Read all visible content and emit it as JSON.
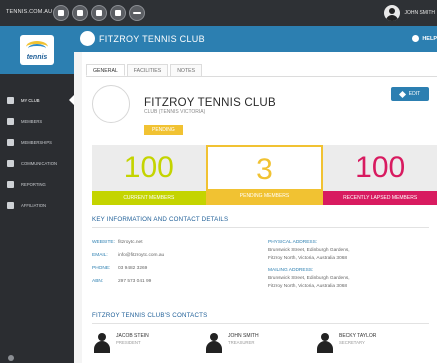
{
  "topbar": {
    "brand": "TENNIS.COM.AU",
    "icons": [
      "square-icon",
      "shield-icon",
      "chat-icon",
      "star-icon",
      "more-icon"
    ],
    "user_name": "JOHN SMITH"
  },
  "sidebar": {
    "logo_text": "tennis",
    "items": [
      {
        "label": "MY CLUB",
        "icon": "home-icon"
      },
      {
        "label": "MEMBERS",
        "icon": "members-icon"
      },
      {
        "label": "MEMBERSHIPS",
        "icon": "memberships-icon"
      },
      {
        "label": "COMMUNICATION",
        "icon": "communication-icon"
      },
      {
        "label": "REPORTING",
        "icon": "reporting-icon"
      },
      {
        "label": "AFFILIATION",
        "icon": "affiliation-icon"
      }
    ]
  },
  "header": {
    "title": "FITZROY TENNIS CLUB",
    "help_label": "HELP"
  },
  "tabs": [
    "GENERAL",
    "FACILITIES",
    "NOTES"
  ],
  "club": {
    "name": "FITZROY TENNIS CLUB",
    "subtitle": "CLUB (TENNIS VICTORIA)",
    "status": "PENDING",
    "edit_label": "EDIT"
  },
  "stats": [
    {
      "value": "100",
      "label": "CURRENT MEMBERS"
    },
    {
      "value": "3",
      "label": "PENDING MEMBERS"
    },
    {
      "value": "100",
      "label": "RECENTLY LAPSED MEMBERS"
    }
  ],
  "info": {
    "title": "KEY INFORMATION AND CONTACT DETAILS",
    "website_label": "WEBSITE:",
    "website": "fitzroytc.net",
    "email_label": "EMAIL:",
    "email": "info@fitzroytc.com.au",
    "phone_label": "PHONE:",
    "phone": "03 9482 3269",
    "abn_label": "ABN:",
    "abn": "297 573 041 99",
    "physical_label": "PHYSICAL ADDRESS:",
    "physical_line1": "Brunswick Street, Edinburgh Gardens,",
    "physical_line2": "Fitzroy North, Victoria, Australia 3068",
    "mailing_label": "MAILING ADDRESS:",
    "mailing_line1": "Brunswick Street, Edinburgh Gardens,",
    "mailing_line2": "Fitzroy North, Victoria, Australia 3068"
  },
  "contacts": {
    "title": "FITZROY TENNIS CLUB'S CONTACTS",
    "people": [
      {
        "name": "JACOB STEIN",
        "role": "PRESIDENT"
      },
      {
        "name": "JOHN SMITH",
        "role": "TREASURER"
      },
      {
        "name": "BECKY TAYLOR",
        "role": "SECRETARY"
      }
    ]
  }
}
